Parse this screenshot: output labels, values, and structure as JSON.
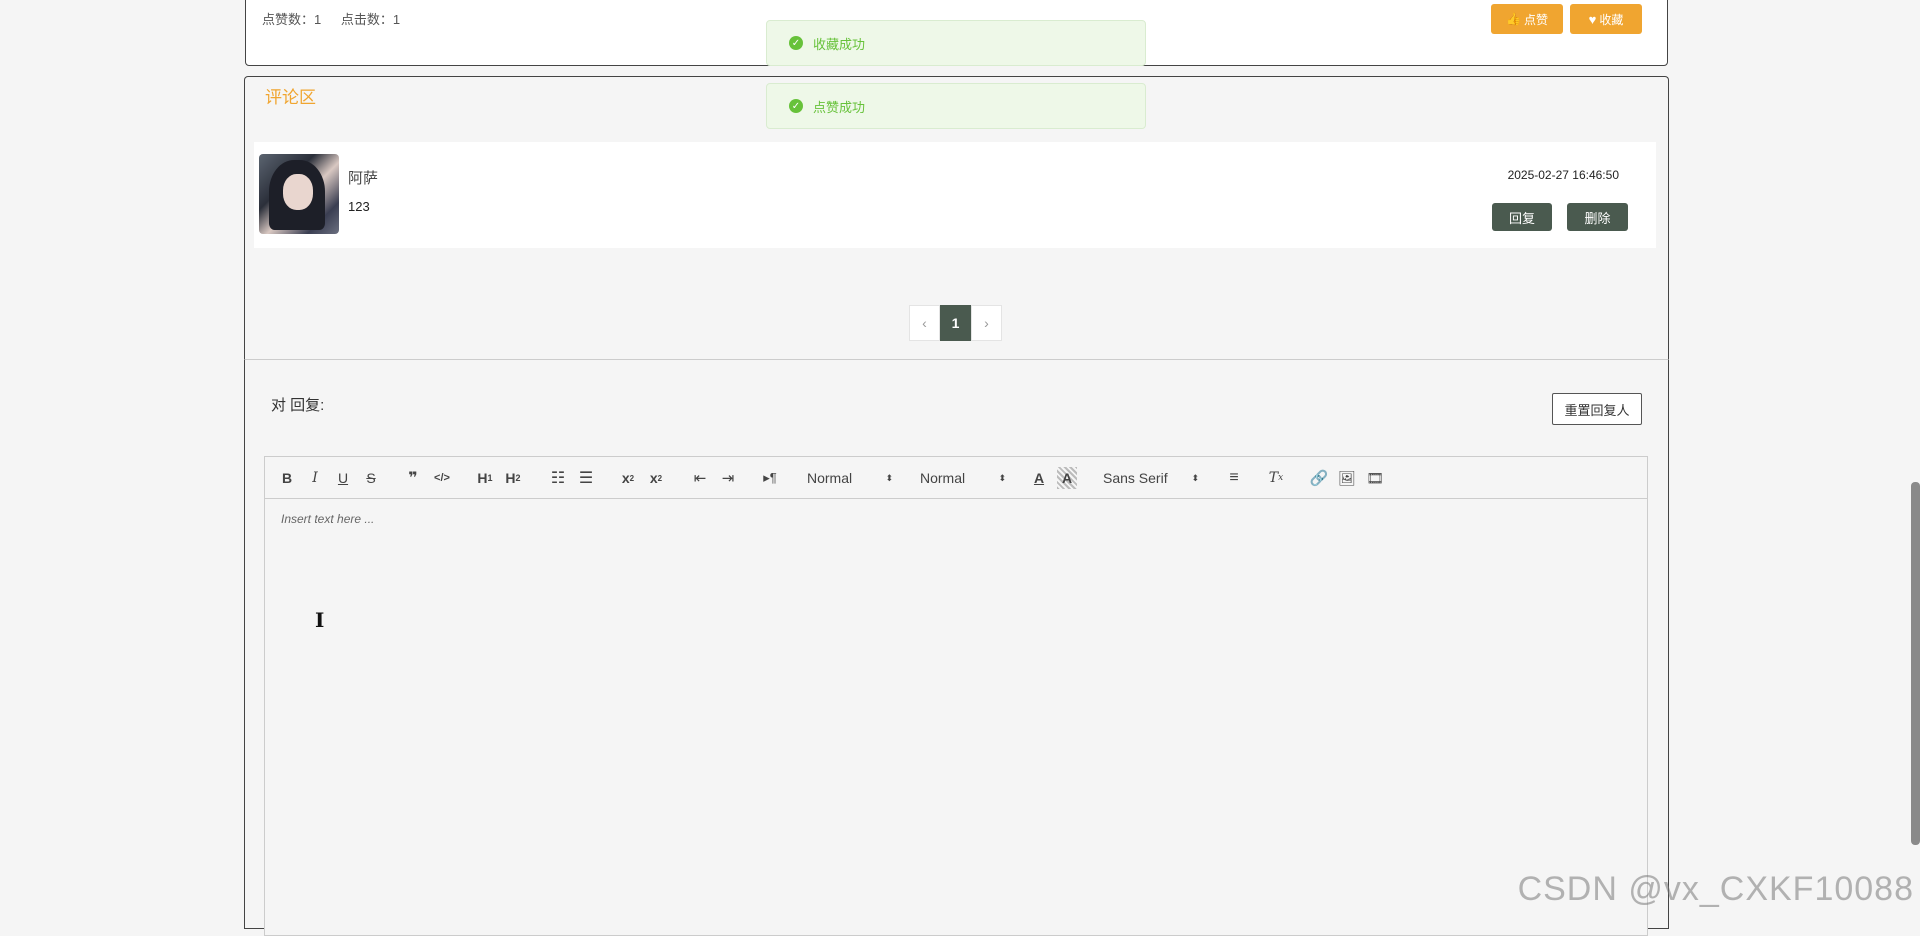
{
  "article": {
    "likes_label": "点赞数：1",
    "clicks_label": "点击数：1",
    "like_button": "点赞",
    "favorite_button": "收藏"
  },
  "toasts": [
    "收藏成功",
    "点赞成功"
  ],
  "comments": {
    "title": "评论区",
    "items": [
      {
        "name": "阿萨",
        "content": "123",
        "time": "2025-02-27 16:46:50",
        "reply_label": "回复",
        "delete_label": "删除"
      }
    ]
  },
  "pagination": {
    "prev": "‹",
    "current": "1",
    "next": "›"
  },
  "reply": {
    "label": "对 回复:",
    "reset_button": "重置回复人"
  },
  "editor": {
    "placeholder": "Insert text here ...",
    "header_select": "Normal",
    "size_select": "Normal",
    "font_select": "Sans Serif"
  },
  "watermark": "CSDN @vx_CXKF10088"
}
